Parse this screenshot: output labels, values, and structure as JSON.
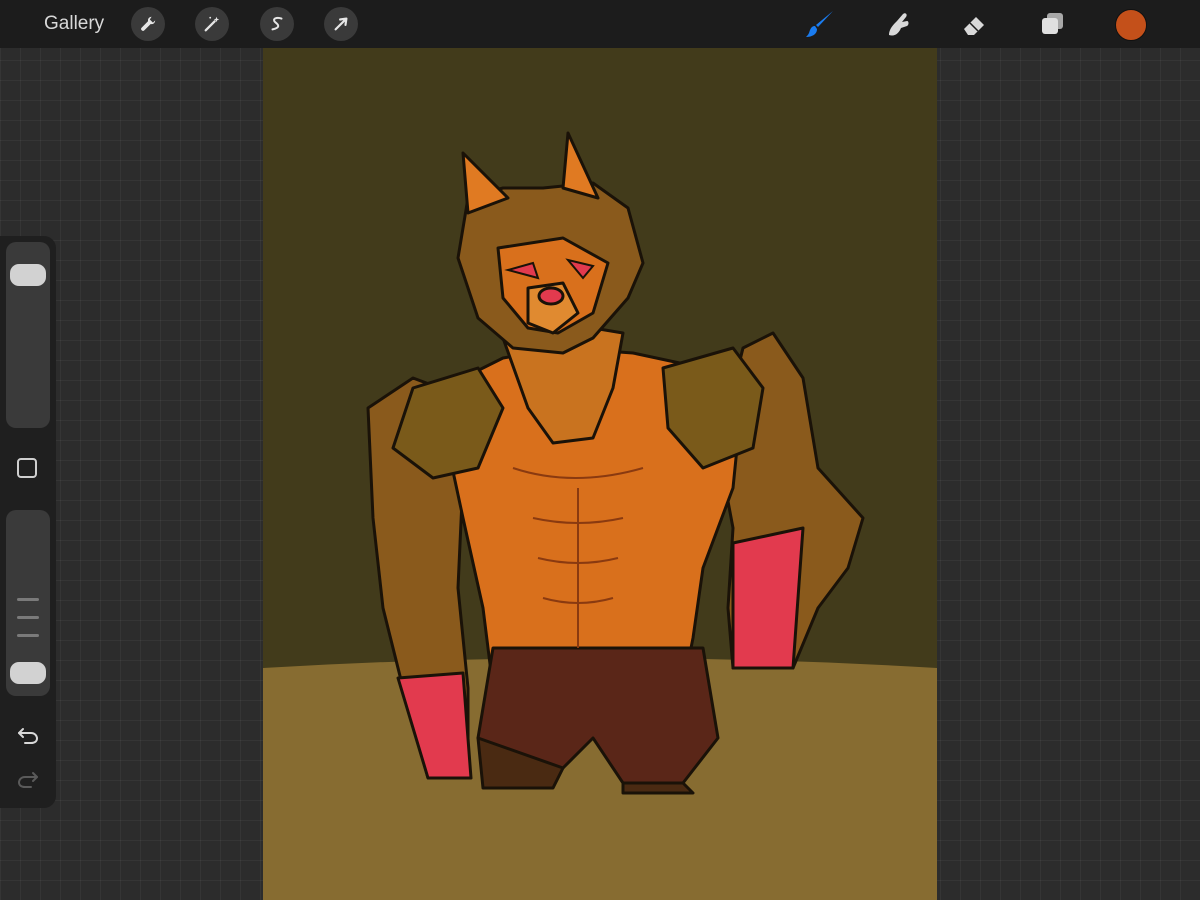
{
  "topbar": {
    "gallery_label": "Gallery",
    "left_tools": [
      {
        "name": "actions",
        "icon": "wrench-icon"
      },
      {
        "name": "adjustments",
        "icon": "magic-wand-icon"
      },
      {
        "name": "selection",
        "icon": "selection-s-icon"
      },
      {
        "name": "transform",
        "icon": "arrow-cursor-icon"
      }
    ],
    "right_tools": [
      {
        "name": "brush",
        "icon": "paintbrush-icon",
        "active": true
      },
      {
        "name": "smudge",
        "icon": "smudge-finger-icon",
        "active": false
      },
      {
        "name": "eraser",
        "icon": "eraser-icon",
        "active": false
      },
      {
        "name": "layers",
        "icon": "layers-icon",
        "active": false
      }
    ],
    "current_color": "#c4501a",
    "active_color": "#1a7cf0"
  },
  "sidebar": {
    "size_slider_level": 0.95,
    "opacity_slider_level": 0.05,
    "icons": [
      "modify-square-icon",
      "undo-icon",
      "redo-icon"
    ]
  },
  "canvas": {
    "background_color": "#423b1b",
    "ground_color": "#876c31",
    "artwork": "werewolf-illustration"
  }
}
